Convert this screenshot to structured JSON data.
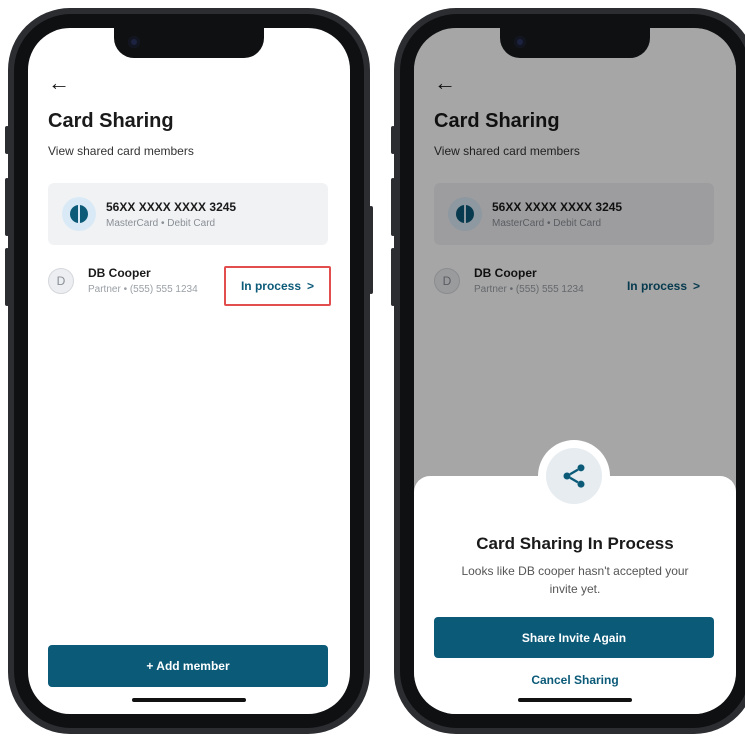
{
  "screens": [
    {
      "back_icon": "←",
      "title": "Card Sharing",
      "subtitle": "View shared card members",
      "card": {
        "number": "56XX XXXX XXXX 3245",
        "type": "MasterCard • Debit Card"
      },
      "member": {
        "initial": "D",
        "name": "DB Cooper",
        "info": "Partner • (555) 555 1234",
        "status": "In process",
        "chevron": ">"
      },
      "add_button": "+ Add member"
    },
    {
      "back_icon": "←",
      "title": "Card Sharing",
      "subtitle": "View shared card members",
      "card": {
        "number": "56XX XXXX XXXX 3245",
        "type": "MasterCard • Debit Card"
      },
      "member": {
        "initial": "D",
        "name": "DB Cooper",
        "info": "Partner • (555) 555 1234",
        "status": "In process",
        "chevron": ">"
      },
      "sheet": {
        "icon": "share-icon",
        "title": "Card Sharing In Process",
        "description": "Looks like DB cooper hasn't accepted your invite yet.",
        "primary_button": "Share Invite Again",
        "secondary_button": "Cancel Sharing"
      }
    }
  ],
  "colors": {
    "primary": "#0b5a78",
    "highlight": "#e24d4d",
    "card_bg": "#f1f2f4"
  }
}
